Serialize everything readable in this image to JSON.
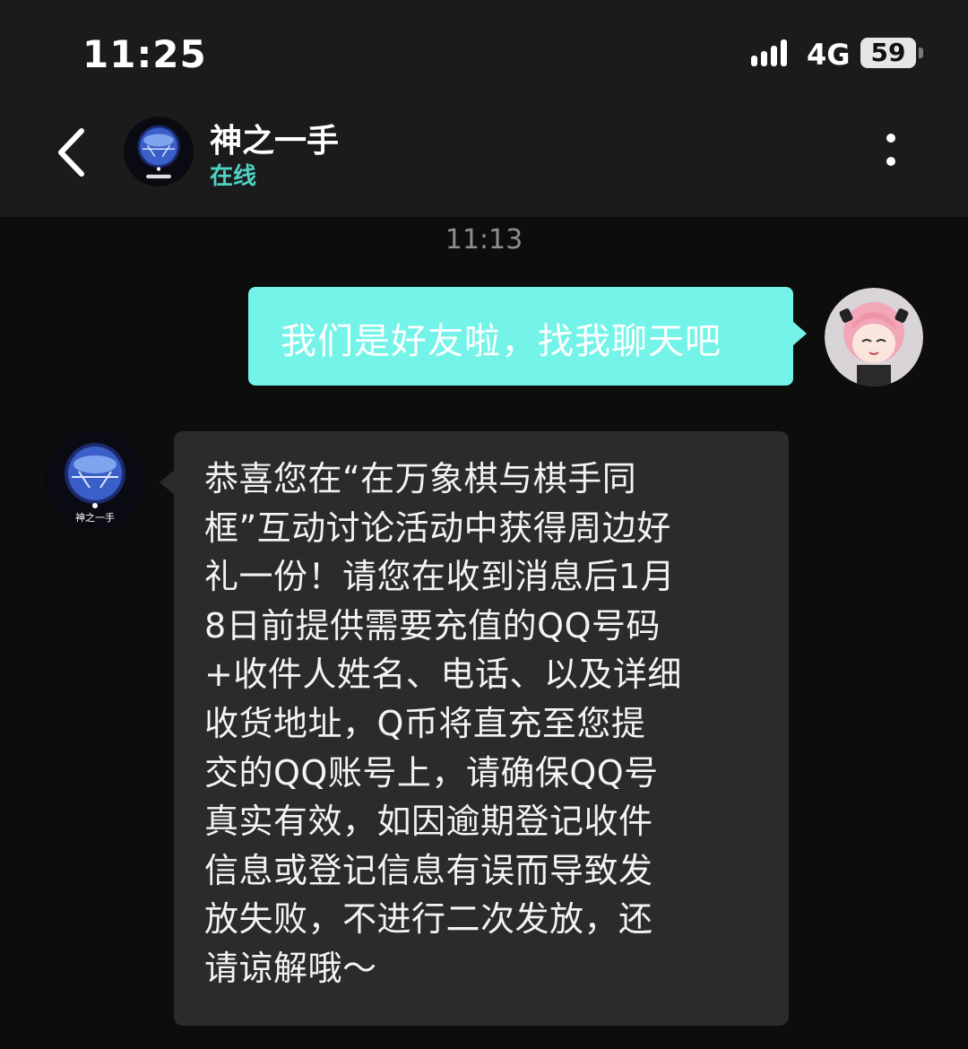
{
  "status_bar": {
    "time": "11:25",
    "network": "4G",
    "battery": "59"
  },
  "header": {
    "contact_name": "神之一手",
    "contact_status": "在线",
    "avatar_caption": "神之一手"
  },
  "messages": {
    "timestamp": "11:13",
    "sent": {
      "text": "我们是好友啦，找我聊天吧"
    },
    "received": {
      "lines": [
        "恭喜您在“在万象棋与棋手同",
        "框”互动讨论活动中获得周边好",
        "礼一份！请您在收到消息后1月",
        "8日前提供需要充值的QQ号码",
        "+收件人姓名、电话、以及详细",
        "收货地址，Q币将直充至您提",
        "交的QQ账号上，请确保QQ号",
        "真实有效，如因逾期登记收件",
        "信息或登记信息有误而导致发",
        "放失败，不进行二次发放，还",
        "请谅解哦～"
      ]
    }
  },
  "colors": {
    "sent_bubble": "#74f4e8",
    "received_bubble": "#2b2b2b",
    "online_status": "#4fd2c2",
    "header_background": "#1b1b1b",
    "page_background": "#0d0d0d"
  },
  "icons": [
    "back-arrow-icon",
    "more-vertical-icon",
    "cellular-signal-icon",
    "battery-icon"
  ]
}
